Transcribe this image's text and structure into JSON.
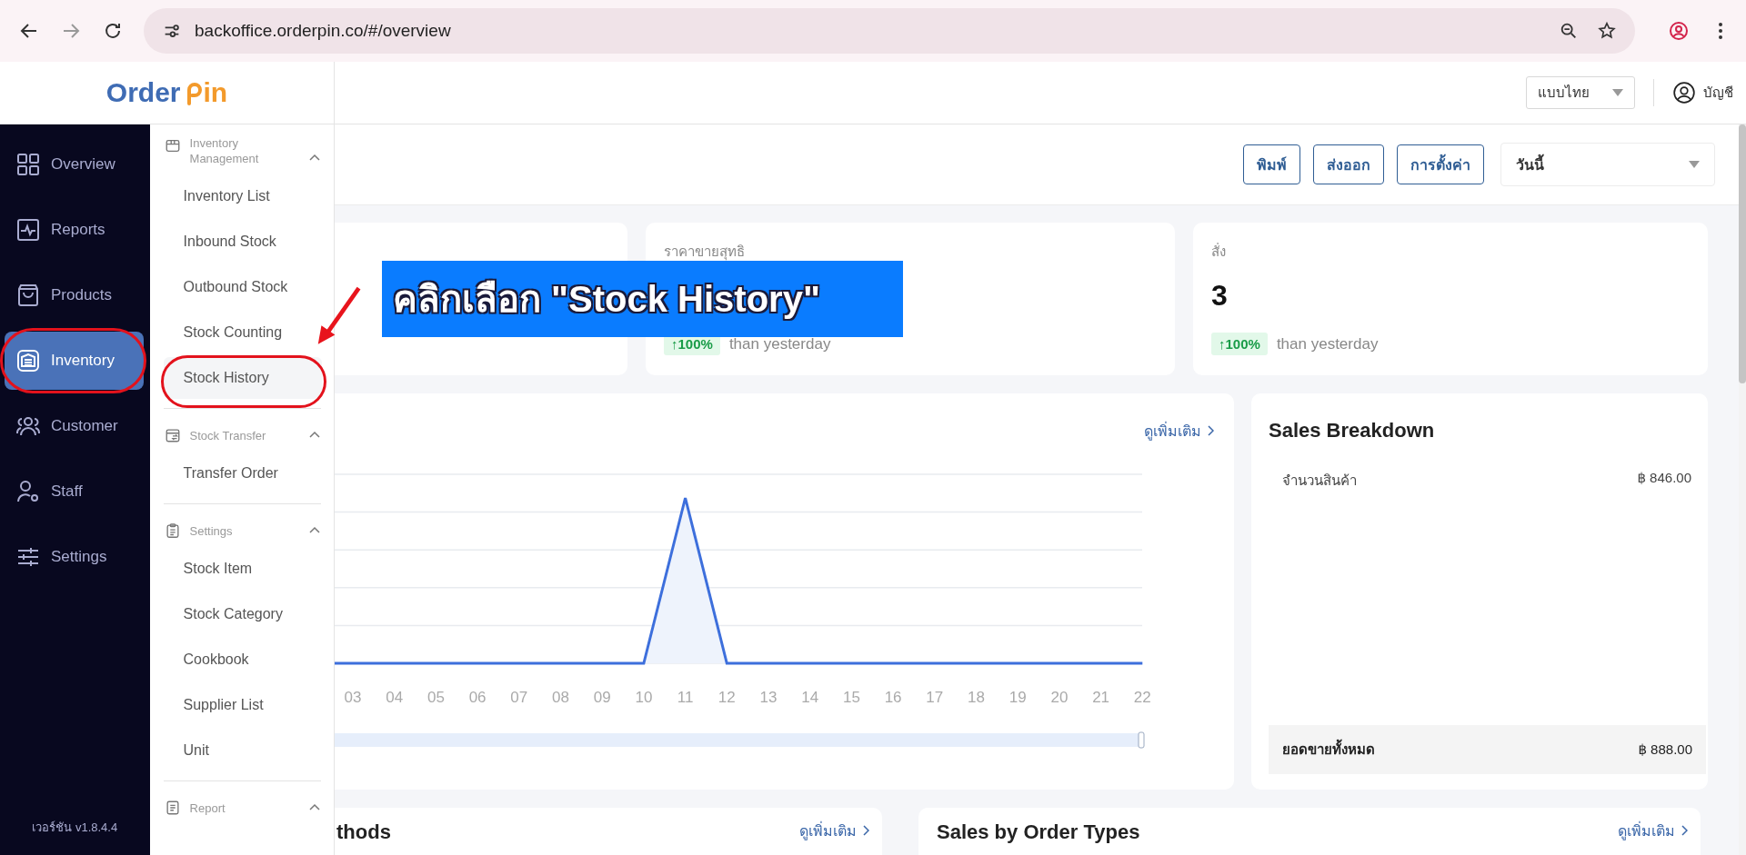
{
  "browser": {
    "url": "backoffice.orderpin.co/#/overview"
  },
  "logo": {
    "part1": "Order",
    "part2": "in"
  },
  "header": {
    "language": "แบบไทย",
    "account": "บัญชี"
  },
  "sidebar": {
    "items": [
      {
        "label": "Overview",
        "selected": false,
        "highlighted": false
      },
      {
        "label": "Reports",
        "selected": false,
        "highlighted": false
      },
      {
        "label": "Products",
        "selected": false,
        "highlighted": false
      },
      {
        "label": "Inventory",
        "selected": true,
        "highlighted": true
      },
      {
        "label": "Customer",
        "selected": false,
        "highlighted": false
      },
      {
        "label": "Staff",
        "selected": false,
        "highlighted": false
      },
      {
        "label": "Settings",
        "selected": false,
        "highlighted": false
      }
    ],
    "version": "เวอร์ชัน v1.8.4.4"
  },
  "flyout": {
    "groups": [
      {
        "label": "Inventory Management",
        "expanded": true,
        "items": [
          {
            "label": "Inventory List",
            "selected": false,
            "highlighted": false
          },
          {
            "label": "Inbound Stock",
            "selected": false,
            "highlighted": false
          },
          {
            "label": "Outbound Stock",
            "selected": false,
            "highlighted": false
          },
          {
            "label": "Stock Counting",
            "selected": false,
            "highlighted": false
          },
          {
            "label": "Stock History",
            "selected": true,
            "highlighted": true
          }
        ]
      },
      {
        "label": "Stock Transfer",
        "expanded": true,
        "items": [
          {
            "label": "Transfer Order",
            "selected": false,
            "highlighted": false
          }
        ]
      },
      {
        "label": "Settings",
        "expanded": true,
        "items": [
          {
            "label": "Stock Item",
            "selected": false,
            "highlighted": false
          },
          {
            "label": "Stock Category",
            "selected": false,
            "highlighted": false
          },
          {
            "label": "Cookbook",
            "selected": false,
            "highlighted": false
          },
          {
            "label": "Supplier List",
            "selected": false,
            "highlighted": false
          },
          {
            "label": "Unit",
            "selected": false,
            "highlighted": false
          }
        ]
      },
      {
        "label": "Report",
        "expanded": true
      }
    ]
  },
  "toolbar": {
    "buttons": [
      "พิมพ์",
      "ส่งออก",
      "การตั้งค่า"
    ],
    "period": "วันนี้"
  },
  "stats": [
    {
      "label": "ราคาขายสุทธิ",
      "change": "↑100%",
      "comparison": "than yesterday"
    },
    {
      "label": "สั่ง",
      "value": "3",
      "change": "↑100%",
      "comparison": "than yesterday"
    }
  ],
  "sales_chart": {
    "link": "ดูเพิ่มเติม",
    "x_labels": [
      "03",
      "04",
      "05",
      "06",
      "07",
      "08",
      "09",
      "10",
      "11",
      "12",
      "13",
      "14",
      "15",
      "16",
      "17",
      "18",
      "19",
      "20",
      "21",
      "22"
    ],
    "slider": {
      "level": 1
    }
  },
  "sales_breakdown": {
    "title": "Sales Breakdown",
    "rows": [
      {
        "label": "จำนวนสินค้า",
        "amount": "฿ 846.00"
      }
    ],
    "total": {
      "label": "ยอดขายทั้งหมด",
      "amount": "฿ 888.00"
    }
  },
  "payment_methods": {
    "title": "thods",
    "link": "ดูเพิ่มเติม"
  },
  "order_types": {
    "title": "Sales by Order Types",
    "link": "ดูเพิ่มเติม"
  },
  "annotation": {
    "text": "คลิกเลือก \"Stock History\""
  }
}
